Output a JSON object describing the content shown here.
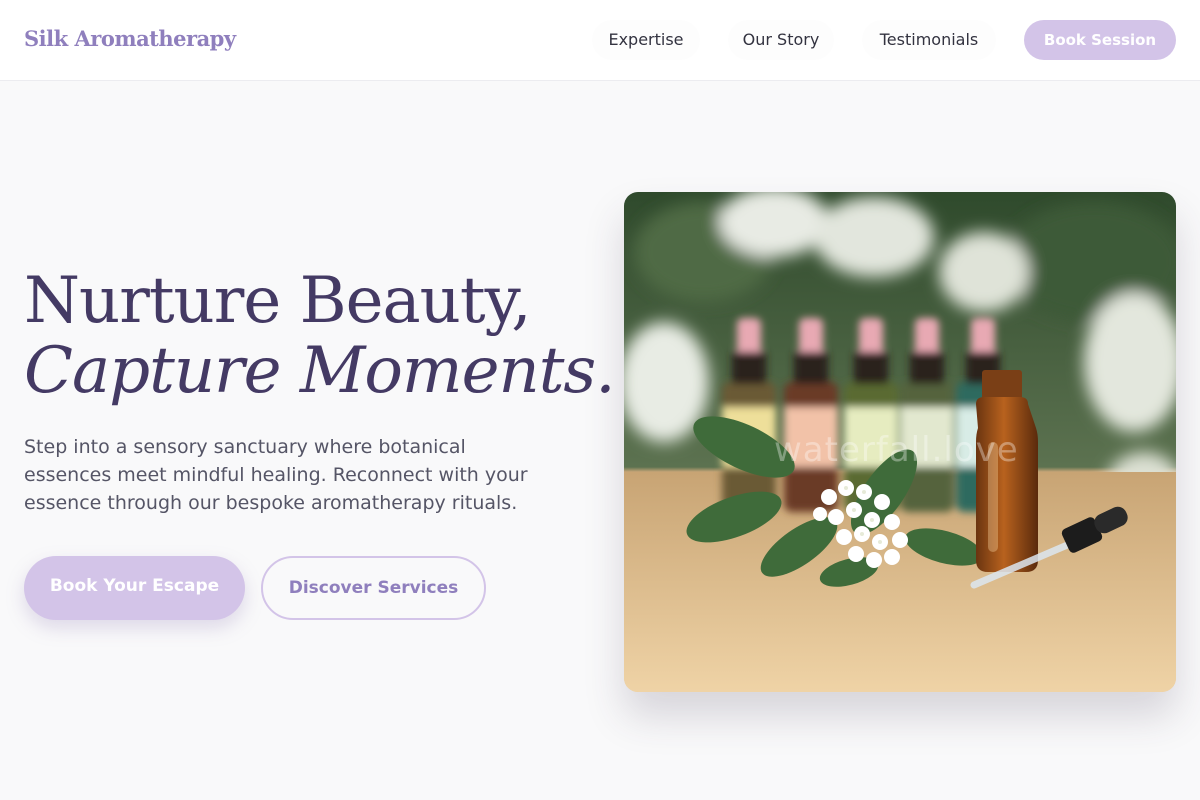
{
  "header": {
    "logo": "Silk Aromatherapy",
    "nav": [
      "Expertise",
      "Our Story",
      "Testimonials"
    ],
    "cta": "Book Session"
  },
  "hero": {
    "title_line1": "Nurture Beauty,",
    "title_line2": "Capture Moments.",
    "description": "Step into a sensory sanctuary where botanical essences meet mindful healing. Reconnect with your essence through our bespoke aromatherapy rituals.",
    "primary_button": "Book Your Escape",
    "secondary_button": "Discover Services",
    "image_watermark": "waterfall.love"
  },
  "colors": {
    "accent": "#d3c4e8",
    "accent_text": "#8f7fbd",
    "heading": "#443a64",
    "body_text": "#555566",
    "background": "#f9f9fa"
  }
}
